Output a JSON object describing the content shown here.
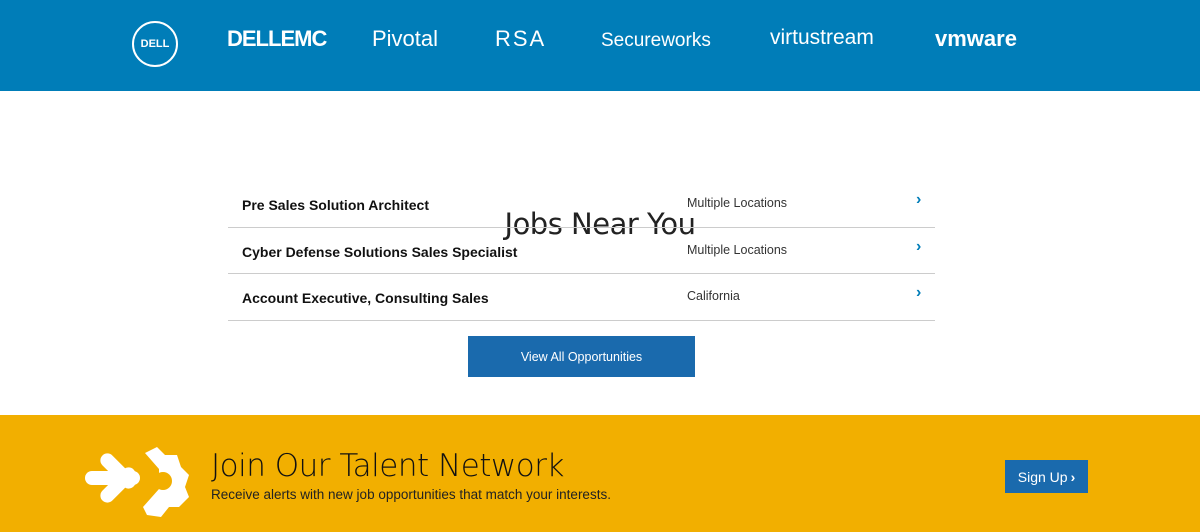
{
  "brands": [
    "DELL",
    "DELLEMC",
    "Pivotal",
    "RSA",
    "Secureworks",
    "virtustream",
    "vmware"
  ],
  "title": "Jobs Near You",
  "jobs": [
    {
      "title": "Pre Sales Solution Architect",
      "location": "Multiple Locations"
    },
    {
      "title": "Cyber Defense Solutions Sales Specialist",
      "location": "Multiple Locations"
    },
    {
      "title": "Account Executive, Consulting Sales",
      "location": "California"
    }
  ],
  "view_all": "View All Opportunities",
  "talent": {
    "title": "Join Our Talent Network",
    "subtitle": "Receive alerts with new job opportunities that match your interests.",
    "button": "Sign Up"
  },
  "colors": {
    "header": "#007db8",
    "band": "#f2af00",
    "button": "#1a6aad"
  }
}
